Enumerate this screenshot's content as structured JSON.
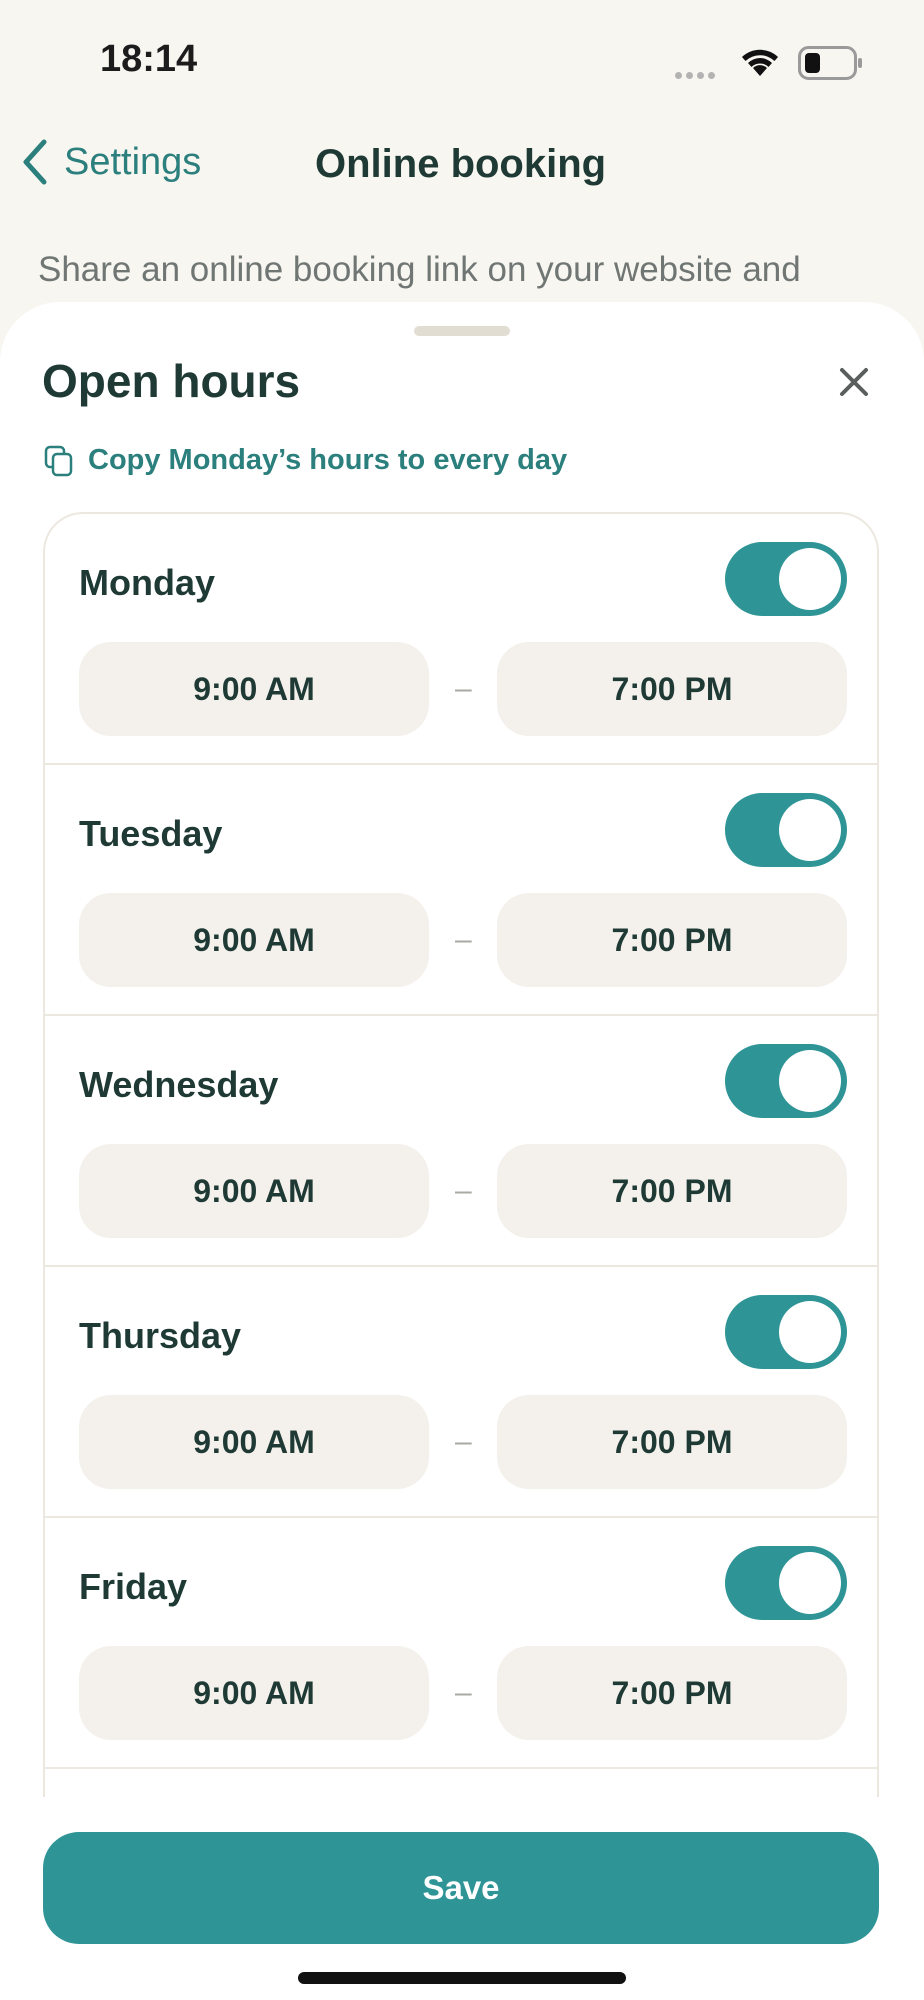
{
  "status_bar": {
    "time": "18:14"
  },
  "nav": {
    "back_label": "Settings",
    "title": "Online booking"
  },
  "background_text": "Share an online booking link on your website and",
  "sheet": {
    "title": "Open hours",
    "copy_label": "Copy Monday’s hours to every day",
    "days": [
      {
        "name": "Monday",
        "enabled": true,
        "start": "9:00 AM",
        "end": "7:00 PM"
      },
      {
        "name": "Tuesday",
        "enabled": true,
        "start": "9:00 AM",
        "end": "7:00 PM"
      },
      {
        "name": "Wednesday",
        "enabled": true,
        "start": "9:00 AM",
        "end": "7:00 PM"
      },
      {
        "name": "Thursday",
        "enabled": true,
        "start": "9:00 AM",
        "end": "7:00 PM"
      },
      {
        "name": "Friday",
        "enabled": true,
        "start": "9:00 AM",
        "end": "7:00 PM"
      }
    ],
    "range_separator": "–",
    "save_label": "Save"
  },
  "colors": {
    "accent": "#2e9496",
    "text": "#1f3a35",
    "pill_bg": "#f4f1ec",
    "bg": "#f8f6f1"
  }
}
